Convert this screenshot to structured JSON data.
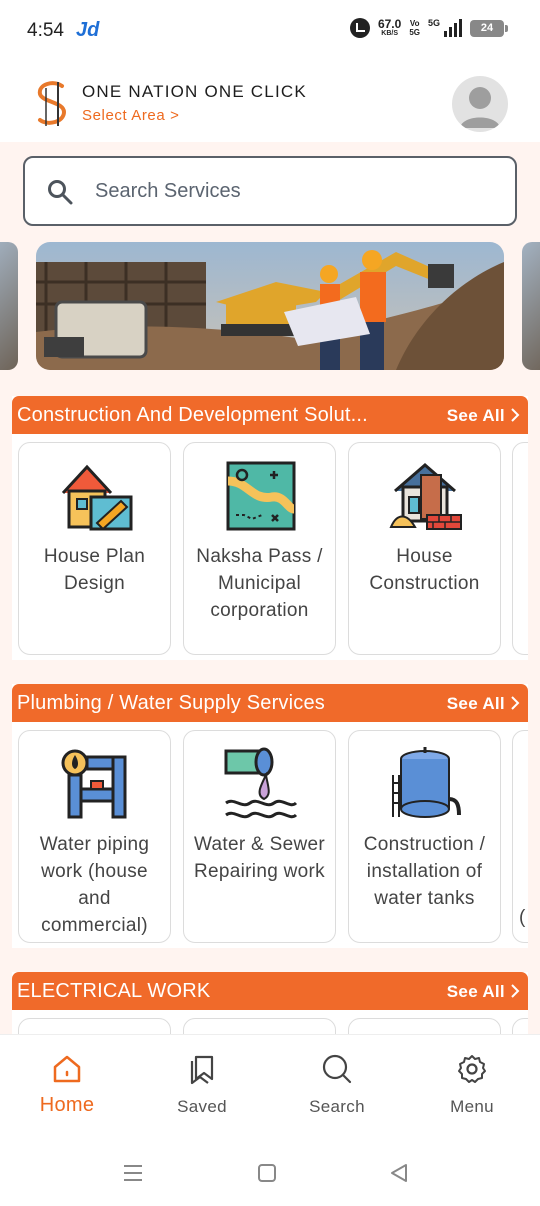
{
  "status_bar": {
    "time": "4:54",
    "app_badge": "Jd",
    "net_speed": "67.0",
    "net_unit": "KB/S",
    "volte_top": "Vo",
    "volte_bottom": "5G",
    "network": "5G",
    "battery": "24"
  },
  "header": {
    "title": "ONE NATION ONE CLICK",
    "select_area": "Select Area >"
  },
  "search": {
    "placeholder": "Search Services"
  },
  "sections": [
    {
      "title": "Construction And Development Solut...",
      "see_all": "See All",
      "cards": [
        {
          "label": "House Plan Design",
          "icon": "house-plan-icon"
        },
        {
          "label": "Naksha Pass / Municipal corporation",
          "icon": "map-icon"
        },
        {
          "label": "House Construction",
          "icon": "house-construction-icon"
        }
      ]
    },
    {
      "title": "Plumbing / Water Supply Services",
      "see_all": "See All",
      "cards": [
        {
          "label": "Water piping work (house and commercial)",
          "icon": "water-pipes-icon"
        },
        {
          "label": "Water & Sewer Repairing work",
          "icon": "sewer-pipe-icon"
        },
        {
          "label": "Construction / installation of water tanks",
          "icon": "water-tank-icon"
        }
      ],
      "peek_text": "("
    },
    {
      "title": "ELECTRICAL WORK",
      "see_all": "See All"
    }
  ],
  "bottom_nav": [
    {
      "label": "Home",
      "icon": "home-icon",
      "active": true
    },
    {
      "label": "Saved",
      "icon": "saved-icon"
    },
    {
      "label": "Search",
      "icon": "search-icon"
    },
    {
      "label": "Menu",
      "icon": "gear-icon"
    }
  ],
  "colors": {
    "accent": "#f06a2a",
    "background_tint": "#fff4f0"
  }
}
